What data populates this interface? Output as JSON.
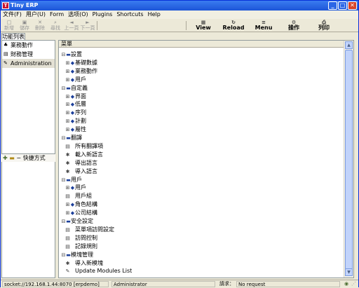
{
  "window": {
    "title": "Tiny ERP"
  },
  "menu": [
    "文件(F)",
    "用户(U)",
    "Form",
    "选项(O)",
    "Plugins",
    "Shortcuts",
    "Help"
  ],
  "toolbar": [
    {
      "label": "新增",
      "icon": "new-icon",
      "glyph": "□"
    },
    {
      "label": "儲存",
      "icon": "save-icon",
      "glyph": "▣"
    },
    {
      "label": "刪除",
      "icon": "delete-icon",
      "glyph": "✕"
    },
    {
      "label": "尋找",
      "icon": "find-icon",
      "glyph": "⌕"
    },
    {
      "label": "上一頁",
      "icon": "previous-icon",
      "glyph": "◄"
    },
    {
      "label": "下一頁",
      "icon": "next-icon",
      "glyph": "►"
    },
    {
      "label": "View",
      "icon": "view-icon",
      "glyph": "▦"
    },
    {
      "label": "Reload",
      "icon": "reload-icon",
      "glyph": "↻"
    },
    {
      "label": "Menu",
      "icon": "menu-icon",
      "glyph": "≡"
    },
    {
      "label": "操作",
      "icon": "action-icon",
      "glyph": "⚙"
    },
    {
      "label": "列印",
      "icon": "print-icon",
      "glyph": "⎙"
    }
  ],
  "left": {
    "tab": "功能列表",
    "items": [
      {
        "label": "業務動作",
        "icon": "sales-icon",
        "glyph": "♣"
      },
      {
        "label": "財務管理",
        "icon": "finance-icon",
        "glyph": "▤"
      },
      {
        "label": "Administration",
        "icon": "admin-icon",
        "glyph": "✎"
      }
    ],
    "shortcuts": "快捷方式"
  },
  "tree": {
    "header": "菜單",
    "rows": [
      {
        "text": "設置",
        "depth": 0,
        "node": "collapse-icon",
        "g": "⊟"
      },
      {
        "text": "基礎數據",
        "depth": 1,
        "node": "expand-icon",
        "g": "⊞"
      },
      {
        "text": "業務動作",
        "depth": 1,
        "node": "expand-icon",
        "g": "⊞"
      },
      {
        "text": "用戶",
        "depth": 1,
        "node": "expand-icon",
        "g": "⊞"
      },
      {
        "text": "自定義",
        "depth": 0,
        "node": "collapse-icon",
        "g": "⊟"
      },
      {
        "text": "界面",
        "depth": 1,
        "node": "expand-icon",
        "g": "⊞"
      },
      {
        "text": "低層",
        "depth": 1,
        "node": "expand-icon",
        "g": "⊞"
      },
      {
        "text": "序列",
        "depth": 1,
        "node": "expand-icon",
        "g": "⊞"
      },
      {
        "text": "計劃",
        "depth": 1,
        "node": "expand-icon",
        "g": "⊞"
      },
      {
        "text": "屬性",
        "depth": 1,
        "node": "expand-icon",
        "g": "⊞"
      },
      {
        "text": "翻譯",
        "depth": 0,
        "node": "collapse-icon",
        "g": "⊟"
      },
      {
        "text": "所有翻譯項",
        "depth": 1,
        "node": "list-icon",
        "g": "▤"
      },
      {
        "text": "載入新語言",
        "depth": 1,
        "node": "gear-icon",
        "g": "✱"
      },
      {
        "text": "導出語言",
        "depth": 1,
        "node": "gear-icon",
        "g": "✱"
      },
      {
        "text": "導入語言",
        "depth": 1,
        "node": "gear-icon",
        "g": "✱"
      },
      {
        "text": "用戶",
        "depth": 0,
        "node": "collapse-icon",
        "g": "⊟"
      },
      {
        "text": "用戶",
        "depth": 1,
        "node": "expand-icon",
        "g": "⊞"
      },
      {
        "text": "用戶組",
        "depth": 1,
        "node": "list-icon",
        "g": "▤"
      },
      {
        "text": "角色結構",
        "depth": 1,
        "node": "expand-icon",
        "g": "⊞"
      },
      {
        "text": "公司結構",
        "depth": 1,
        "node": "expand-icon",
        "g": "⊞"
      },
      {
        "text": "安全設定",
        "depth": 0,
        "node": "collapse-icon",
        "g": "⊟"
      },
      {
        "text": "菜單項訪問設定",
        "depth": 1,
        "node": "list-icon",
        "g": "▤"
      },
      {
        "text": "訪問控制",
        "depth": 1,
        "node": "list-icon",
        "g": "▤"
      },
      {
        "text": "記錄規則",
        "depth": 1,
        "node": "list-icon",
        "g": "▤"
      },
      {
        "text": "模塊管理",
        "depth": 0,
        "node": "collapse-icon",
        "g": "⊟"
      },
      {
        "text": "導入新模塊",
        "depth": 1,
        "node": "gear-icon",
        "g": "✱"
      },
      {
        "text": "Update Modules List",
        "depth": 1,
        "node": "wand-icon",
        "g": "✎"
      }
    ]
  },
  "status": {
    "server": "socket://192.168.1.44:8070 [erpdemo]",
    "user": "Administrator",
    "request_label": "請求：",
    "request_value": "No request"
  }
}
